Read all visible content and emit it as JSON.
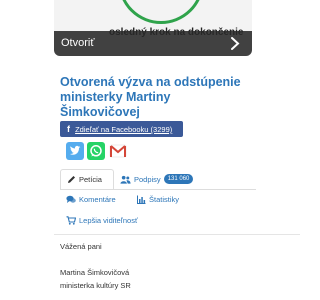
{
  "banner": {
    "step_text": "osledný krok na dokončenie",
    "open_label": "Otvoriť"
  },
  "petition": {
    "title": "Otvorená výzva na odstúpenie ministerky Martiny Šimkovičovej"
  },
  "share": {
    "facebook_label": "Zdieľať na Facebooku (3299)"
  },
  "tabs": {
    "peticia": "Petícia",
    "podpisy": "Podpisy",
    "podpisy_count": "131 060",
    "komentare": "Komentáre",
    "statistiky": "Štatistiky",
    "viditelnost": "Lepšia viditeľnosť"
  },
  "content": {
    "greeting": "Vážená pani",
    "line1": "Martina Šimkovičová",
    "line2": "ministerka kultúry SR"
  },
  "colors": {
    "accent": "#2d76b8",
    "facebook": "#3b5998",
    "twitter": "#55acee",
    "whatsapp": "#25d366",
    "gmail": "#d44638",
    "progress": "#2fa34b"
  }
}
